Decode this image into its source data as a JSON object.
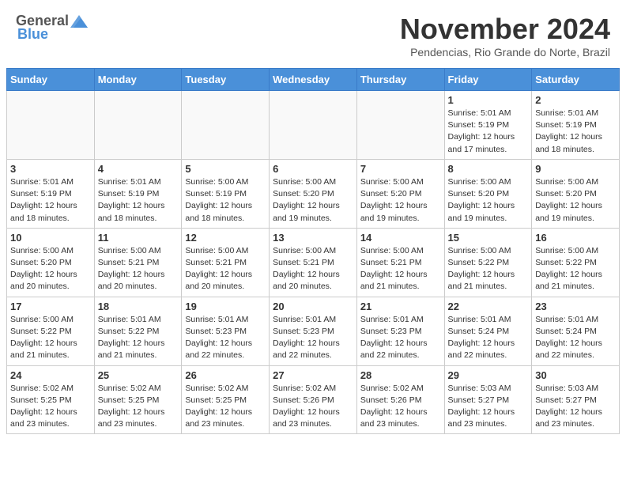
{
  "header": {
    "logo_gen": "General",
    "logo_blue": "Blue",
    "month": "November 2024",
    "location": "Pendencias, Rio Grande do Norte, Brazil"
  },
  "weekdays": [
    "Sunday",
    "Monday",
    "Tuesday",
    "Wednesday",
    "Thursday",
    "Friday",
    "Saturday"
  ],
  "weeks": [
    [
      {
        "day": "",
        "info": ""
      },
      {
        "day": "",
        "info": ""
      },
      {
        "day": "",
        "info": ""
      },
      {
        "day": "",
        "info": ""
      },
      {
        "day": "",
        "info": ""
      },
      {
        "day": "1",
        "info": "Sunrise: 5:01 AM\nSunset: 5:19 PM\nDaylight: 12 hours and 17 minutes."
      },
      {
        "day": "2",
        "info": "Sunrise: 5:01 AM\nSunset: 5:19 PM\nDaylight: 12 hours and 18 minutes."
      }
    ],
    [
      {
        "day": "3",
        "info": "Sunrise: 5:01 AM\nSunset: 5:19 PM\nDaylight: 12 hours and 18 minutes."
      },
      {
        "day": "4",
        "info": "Sunrise: 5:01 AM\nSunset: 5:19 PM\nDaylight: 12 hours and 18 minutes."
      },
      {
        "day": "5",
        "info": "Sunrise: 5:00 AM\nSunset: 5:19 PM\nDaylight: 12 hours and 18 minutes."
      },
      {
        "day": "6",
        "info": "Sunrise: 5:00 AM\nSunset: 5:20 PM\nDaylight: 12 hours and 19 minutes."
      },
      {
        "day": "7",
        "info": "Sunrise: 5:00 AM\nSunset: 5:20 PM\nDaylight: 12 hours and 19 minutes."
      },
      {
        "day": "8",
        "info": "Sunrise: 5:00 AM\nSunset: 5:20 PM\nDaylight: 12 hours and 19 minutes."
      },
      {
        "day": "9",
        "info": "Sunrise: 5:00 AM\nSunset: 5:20 PM\nDaylight: 12 hours and 19 minutes."
      }
    ],
    [
      {
        "day": "10",
        "info": "Sunrise: 5:00 AM\nSunset: 5:20 PM\nDaylight: 12 hours and 20 minutes."
      },
      {
        "day": "11",
        "info": "Sunrise: 5:00 AM\nSunset: 5:21 PM\nDaylight: 12 hours and 20 minutes."
      },
      {
        "day": "12",
        "info": "Sunrise: 5:00 AM\nSunset: 5:21 PM\nDaylight: 12 hours and 20 minutes."
      },
      {
        "day": "13",
        "info": "Sunrise: 5:00 AM\nSunset: 5:21 PM\nDaylight: 12 hours and 20 minutes."
      },
      {
        "day": "14",
        "info": "Sunrise: 5:00 AM\nSunset: 5:21 PM\nDaylight: 12 hours and 21 minutes."
      },
      {
        "day": "15",
        "info": "Sunrise: 5:00 AM\nSunset: 5:22 PM\nDaylight: 12 hours and 21 minutes."
      },
      {
        "day": "16",
        "info": "Sunrise: 5:00 AM\nSunset: 5:22 PM\nDaylight: 12 hours and 21 minutes."
      }
    ],
    [
      {
        "day": "17",
        "info": "Sunrise: 5:00 AM\nSunset: 5:22 PM\nDaylight: 12 hours and 21 minutes."
      },
      {
        "day": "18",
        "info": "Sunrise: 5:01 AM\nSunset: 5:22 PM\nDaylight: 12 hours and 21 minutes."
      },
      {
        "day": "19",
        "info": "Sunrise: 5:01 AM\nSunset: 5:23 PM\nDaylight: 12 hours and 22 minutes."
      },
      {
        "day": "20",
        "info": "Sunrise: 5:01 AM\nSunset: 5:23 PM\nDaylight: 12 hours and 22 minutes."
      },
      {
        "day": "21",
        "info": "Sunrise: 5:01 AM\nSunset: 5:23 PM\nDaylight: 12 hours and 22 minutes."
      },
      {
        "day": "22",
        "info": "Sunrise: 5:01 AM\nSunset: 5:24 PM\nDaylight: 12 hours and 22 minutes."
      },
      {
        "day": "23",
        "info": "Sunrise: 5:01 AM\nSunset: 5:24 PM\nDaylight: 12 hours and 22 minutes."
      }
    ],
    [
      {
        "day": "24",
        "info": "Sunrise: 5:02 AM\nSunset: 5:25 PM\nDaylight: 12 hours and 23 minutes."
      },
      {
        "day": "25",
        "info": "Sunrise: 5:02 AM\nSunset: 5:25 PM\nDaylight: 12 hours and 23 minutes."
      },
      {
        "day": "26",
        "info": "Sunrise: 5:02 AM\nSunset: 5:25 PM\nDaylight: 12 hours and 23 minutes."
      },
      {
        "day": "27",
        "info": "Sunrise: 5:02 AM\nSunset: 5:26 PM\nDaylight: 12 hours and 23 minutes."
      },
      {
        "day": "28",
        "info": "Sunrise: 5:02 AM\nSunset: 5:26 PM\nDaylight: 12 hours and 23 minutes."
      },
      {
        "day": "29",
        "info": "Sunrise: 5:03 AM\nSunset: 5:27 PM\nDaylight: 12 hours and 23 minutes."
      },
      {
        "day": "30",
        "info": "Sunrise: 5:03 AM\nSunset: 5:27 PM\nDaylight: 12 hours and 23 minutes."
      }
    ]
  ]
}
